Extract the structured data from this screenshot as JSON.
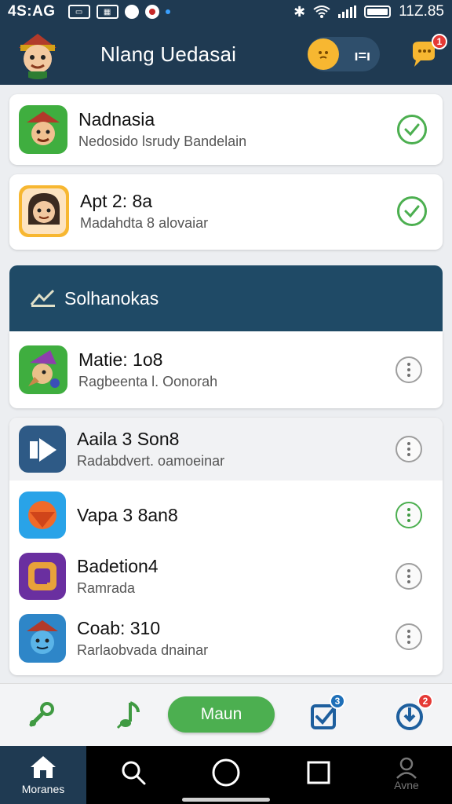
{
  "status_bar": {
    "time": "4S:AG",
    "battery_text": "11Z.85"
  },
  "app_bar": {
    "title": "Nlang Uedasai",
    "toggle_label": "ı=ı",
    "notification_count": "1"
  },
  "cards": [
    {
      "title": "Nadnasia",
      "subtitle": "Nedosido lsrudy Bandelain",
      "status": "checked"
    },
    {
      "title": "Apt 2: 8a",
      "subtitle": "Madahdta 8 alovaiar",
      "status": "checked"
    }
  ],
  "section": {
    "title": "Solhanokas"
  },
  "list_items": [
    {
      "title": "Matie: 1o8",
      "subtitle": "Ragbeenta l. Oonorah"
    },
    {
      "title": "Aaila 3 Son8",
      "subtitle": "Radabdvert. oamoeinar"
    },
    {
      "title": "Vapa 3 8an8",
      "subtitle": ""
    },
    {
      "title": "Badetion4",
      "subtitle": "Ramrada"
    },
    {
      "title": "Coab: 310",
      "subtitle": "Rarlaobvada dnainar"
    }
  ],
  "toolbar": {
    "main_button_label": "Maun",
    "badge_1": "3",
    "badge_2": "2"
  },
  "navbar": {
    "home_label": "Moranes",
    "profile_label": "Avne"
  },
  "colors": {
    "header": "#1f3a52",
    "accent_green": "#4caf50",
    "badge_red": "#e53935",
    "badge_blue": "#1e6fb8"
  }
}
